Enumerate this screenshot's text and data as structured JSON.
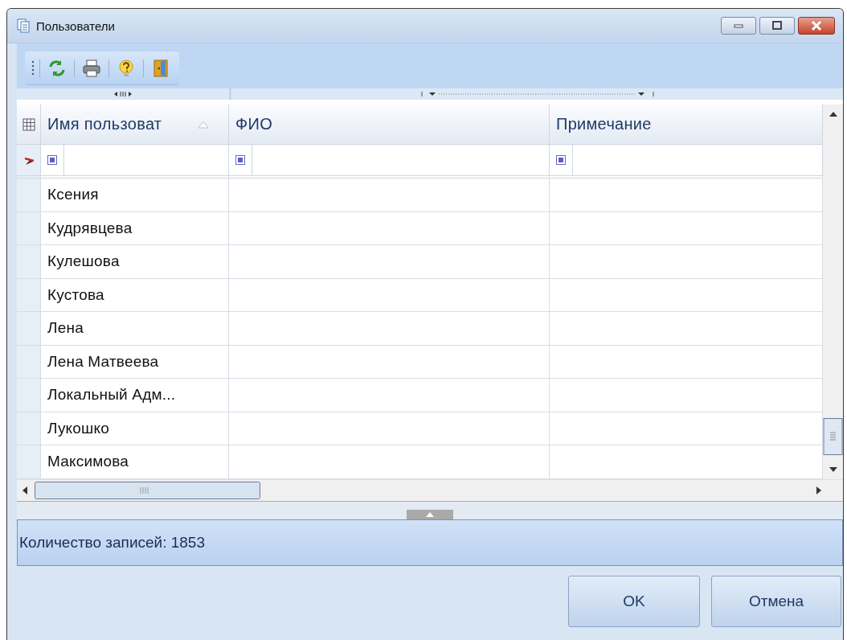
{
  "window": {
    "title": "Пользователи"
  },
  "toolbar": {
    "buttons": [
      {
        "kind": "refresh"
      },
      {
        "kind": "print"
      },
      {
        "kind": "help"
      },
      {
        "kind": "exit"
      }
    ]
  },
  "table": {
    "columns": [
      {
        "label": "Имя пользоват",
        "sorted": true
      },
      {
        "label": "ФИО",
        "sorted": false
      },
      {
        "label": "Примечание",
        "sorted": false
      }
    ],
    "rows": [
      {
        "name": "Ксения"
      },
      {
        "name": "Кудрявцева"
      },
      {
        "name": "Кулешова"
      },
      {
        "name": "Кустова"
      },
      {
        "name": "Лена"
      },
      {
        "name": "Лена Матвеева"
      },
      {
        "name": "Локальный Адм..."
      },
      {
        "name": "Лукошко"
      },
      {
        "name": "Максимова"
      }
    ]
  },
  "status_bar": {
    "text": "Количество записей: 1853"
  },
  "buttons": [
    {
      "label": "OK"
    },
    {
      "label": "Отмена"
    }
  ]
}
